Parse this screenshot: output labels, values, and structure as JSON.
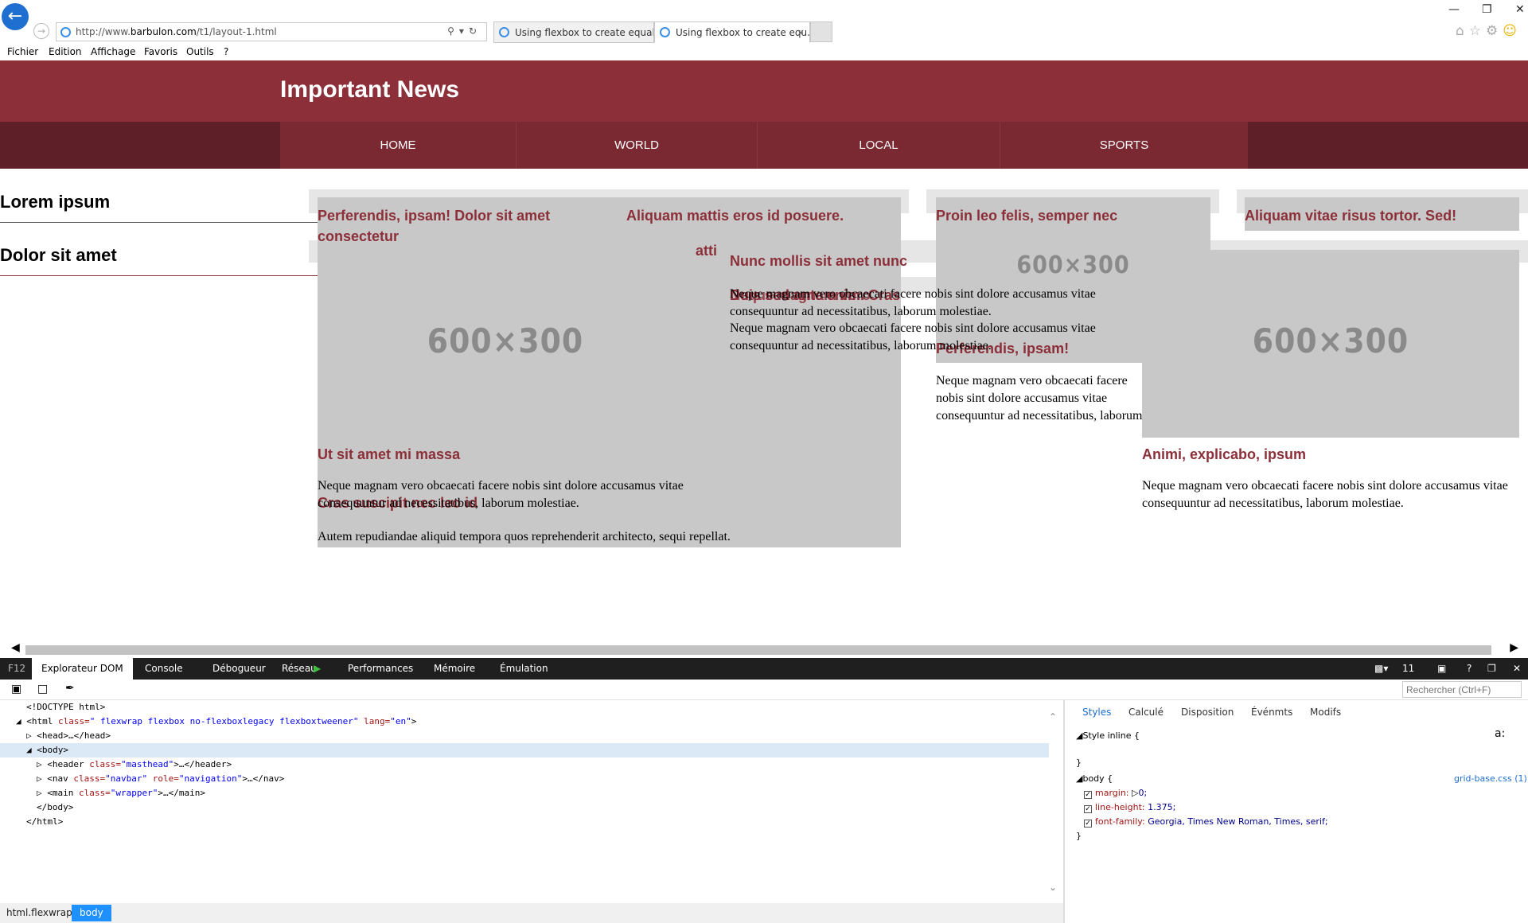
{
  "browser": {
    "url_prefix": "http://www.",
    "url_domain": "barbulon.com",
    "url_path": "/t1/layout-1.html",
    "tabs": [
      {
        "title": "Using flexbox to create equal-h..."
      },
      {
        "title": "Using flexbox to create equ..."
      }
    ],
    "menu": [
      "Fichier",
      "Edition",
      "Affichage",
      "Favoris",
      "Outils",
      "?"
    ]
  },
  "page": {
    "site_title": "Important News",
    "nav": [
      "HOME",
      "WORLD",
      "LOCAL",
      "SPORTS"
    ],
    "sidebar": [
      "Lorem ipsum",
      "Dolor sit amet"
    ],
    "placeholder": "600×300",
    "headings": [
      "Perferendis, ipsam! Dolor sit amet consectetur",
      "Aliquam mattis eros id posuere.",
      "Proin leo felis, semper nec",
      "Aliquam vitae risus tortor. Sed!",
      "Nunc mollis sit amet nunc",
      "Duis sed ante enim. Cras",
      "Perferendis, ipsam!",
      "Ut sit amet mi massa",
      "Animi, explicabo, ipsum",
      "Cras suscipit nec leo id",
      "Neque magnam vero"
    ],
    "frag_atti": "atti",
    "para_neque": "Neque magnam vero obcaecati facere nobis sint dolore accusamus vitae consequuntur ad necessitatibus, laborum molestiae.",
    "para_autem": "Autem repudiandae aliquid tempora quos reprehenderit architecto, sequi repellat."
  },
  "devtools": {
    "f12": "F12",
    "tabs": [
      "Explorateur DOM",
      "Console",
      "Débogueur",
      "Réseau",
      "Performances",
      "Mémoire",
      "Émulation"
    ],
    "doc_mode": "11",
    "search_placeholder": "Rechercher (Ctrl+F)",
    "dom": {
      "l1": "<!DOCTYPE html>",
      "l2_tag": "<html",
      "l2_class_attr": "class=",
      "l2_class_val": "\" flexwrap flexbox no-flexboxlegacy flexboxtweener\"",
      "l2_lang_attr": "lang=",
      "l2_lang_val": "\"en\"",
      "l2_end": ">",
      "l3": "<head>…</head>",
      "l4": "<body>",
      "l5_tag": "<header",
      "l5_attr": "class=",
      "l5_val": "\"masthead\"",
      "l5_end": ">…</header>",
      "l6_tag": "<nav",
      "l6_attr1": "class=",
      "l6_val1": "\"navbar\"",
      "l6_attr2": "role=",
      "l6_val2": "\"navigation\"",
      "l6_end": ">…</nav>",
      "l7_tag": "<main",
      "l7_attr": "class=",
      "l7_val": "\"wrapper\"",
      "l7_end": ">…</main>",
      "l8": "</body>",
      "l9": "</html>"
    },
    "styles_tabs": [
      "Styles",
      "Calculé",
      "Disposition",
      "Événmts",
      "Modifs"
    ],
    "styles": {
      "inline_label": "Style inline  {",
      "close": "}",
      "az": "a:",
      "body_sel": "body  {",
      "source": "grid-base.css (1)",
      "props": [
        {
          "name": "margin:",
          "value": "0;"
        },
        {
          "name": "line-height:",
          "value": "1.375;"
        },
        {
          "name": "font-family:",
          "value": "Georgia, Times New Roman, Times, serif;"
        }
      ]
    },
    "breadcrumb": [
      "html.flexwrap",
      "body"
    ]
  }
}
